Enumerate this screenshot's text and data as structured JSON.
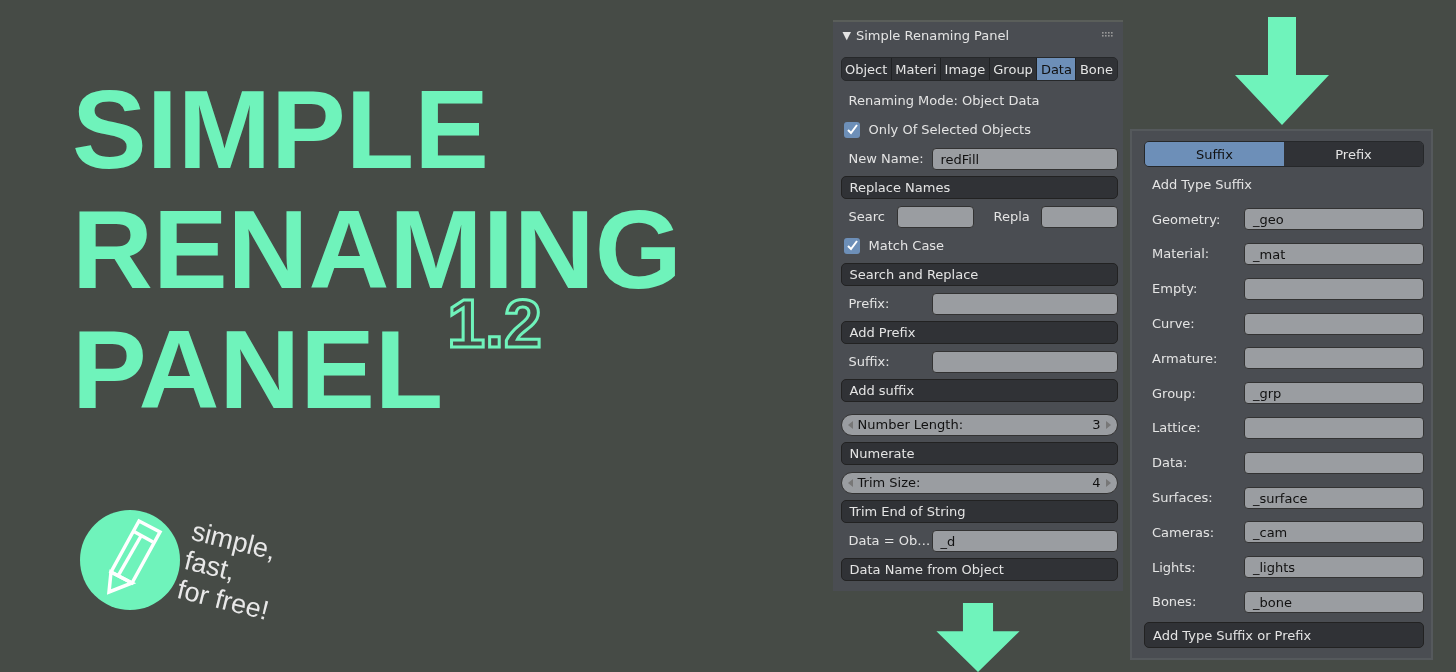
{
  "hero": {
    "title_lines": [
      "SIMPLE",
      "RENAMING",
      "PANEL"
    ],
    "version": "1.2",
    "tagline": [
      "simple,",
      "fast,",
      "for free!"
    ]
  },
  "main_panel": {
    "title": "Simple Renaming Panel",
    "collapse_glyph": "▼",
    "tabs": [
      {
        "label": "Object",
        "selected": false
      },
      {
        "label": "Materi",
        "selected": false
      },
      {
        "label": "Image",
        "selected": false
      },
      {
        "label": "Group",
        "selected": false
      },
      {
        "label": "Data",
        "selected": true
      },
      {
        "label": "Bone",
        "selected": false
      }
    ],
    "rows": [
      {
        "kind": "label",
        "text": "Renaming Mode: Object Data"
      },
      {
        "kind": "checkbox",
        "label": "Only Of Selected Objects",
        "checked": true
      },
      {
        "kind": "field",
        "label": "New Name:",
        "value": "redFill"
      },
      {
        "kind": "button",
        "label": "Replace Names"
      },
      {
        "kind": "pair",
        "label": "Searc",
        "label2": "Repla"
      },
      {
        "kind": "checkbox",
        "label": "Match Case",
        "checked": true
      },
      {
        "kind": "button",
        "label": "Search and Replace"
      },
      {
        "kind": "field",
        "label": "Prefix:"
      },
      {
        "kind": "button",
        "label": "Add Prefix"
      },
      {
        "kind": "field",
        "label": "Suffix:"
      },
      {
        "kind": "button",
        "label": "Add suffix"
      },
      {
        "kind": "number",
        "label": "Number Length:",
        "value": "3"
      },
      {
        "kind": "button",
        "label": "Numerate"
      },
      {
        "kind": "number",
        "label": "Trim Size:",
        "value": "4"
      },
      {
        "kind": "button",
        "label": "Trim End of String"
      },
      {
        "kind": "field",
        "label": "Data = Ob…",
        "value": "_d"
      },
      {
        "kind": "button",
        "label": "Data Name from Object"
      }
    ]
  },
  "type_panel": {
    "tabs": [
      {
        "label": "Suffix",
        "selected": true
      },
      {
        "label": "Prefix",
        "selected": false
      }
    ],
    "heading": "Add Type Suffix",
    "fields": [
      {
        "label": "Geometry:",
        "value": "_geo"
      },
      {
        "label": "Material:",
        "value": "_mat"
      },
      {
        "label": "Empty:"
      },
      {
        "label": "Curve:"
      },
      {
        "label": "Armature:"
      },
      {
        "label": "Group:",
        "value": "_grp"
      },
      {
        "label": "Lattice:"
      },
      {
        "label": "Data:"
      },
      {
        "label": "Surfaces:",
        "value": "_surface"
      },
      {
        "label": "Cameras:",
        "value": "_cam"
      },
      {
        "label": "Lights:",
        "value": "_lights"
      },
      {
        "label": "Bones:",
        "value": "_bone"
      }
    ],
    "button": "Add Type Suffix or Prefix"
  }
}
